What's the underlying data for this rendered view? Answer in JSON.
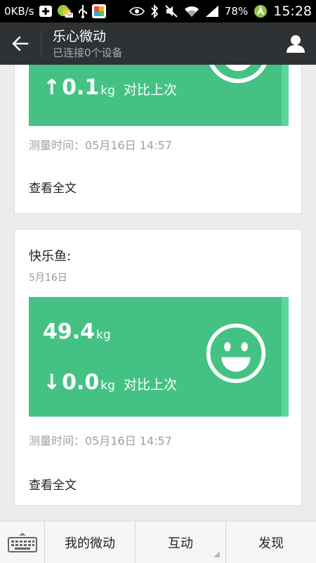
{
  "status_bar": {
    "net_speed": "0KB/s",
    "battery": "78%",
    "time": "15:28",
    "icons": [
      "plus-box-icon",
      "wechat-notify-icon",
      "usb-icon",
      "app-icon",
      "eye-icon",
      "bluetooth-icon",
      "mute-icon",
      "wifi-icon",
      "signal-icon",
      "battery-icon",
      "android-icon"
    ]
  },
  "app_bar": {
    "title": "乐心微动",
    "subtitle": "已连接0个设备"
  },
  "cards": [
    {
      "change_arrow": "↑",
      "change_value": "0.1",
      "unit": "kg",
      "compare_label": "对比上次",
      "measure_time": "测量时间：05月16日 14:57",
      "read_more": "查看全文"
    },
    {
      "author": "快乐鱼:",
      "date": "5月16日",
      "weight_value": "49.4",
      "unit": "kg",
      "change_arrow": "↓",
      "change_value": "0.0",
      "compare_label": "对比上次",
      "measure_time": "测量时间：05月16日 14:57",
      "read_more": "查看全文"
    }
  ],
  "bottom_bar": {
    "tabs": [
      "我的微动",
      "互动",
      "发现"
    ]
  },
  "colors": {
    "accent_green": "#44c283",
    "stripe_green": "#5ed699",
    "app_bar": "#2f3234"
  }
}
